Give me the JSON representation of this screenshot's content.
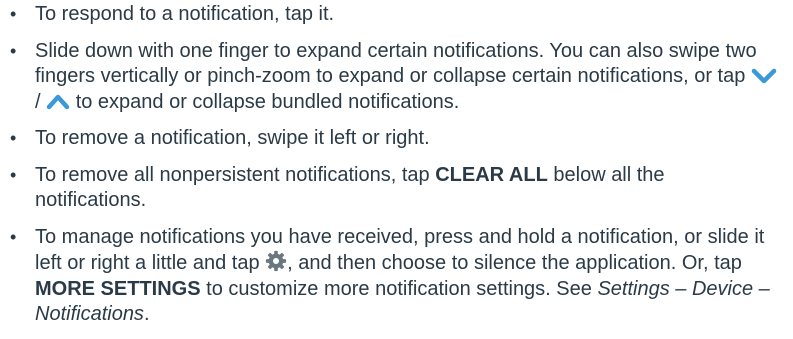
{
  "bullets": [
    {
      "text": "To respond to a notification, tap it."
    },
    {
      "text_before": "Slide down with one finger to expand certain notifications. You can also swipe two fingers vertically or pinch-zoom to expand or collapse certain notifications, or tap",
      "separator": "/",
      "text_after": "to expand or collapse bundled notifications."
    },
    {
      "text": "To remove a notification, swipe it left or right."
    },
    {
      "text_before": "To remove all nonpersistent notifications, tap",
      "bold": "CLEAR ALL",
      "text_after": "below all the notifications."
    },
    {
      "text_before": "To manage notifications you have received, press and hold a notification, or slide it left or right a little and tap",
      "text_middle": ", and then choose to silence the application. Or, tap",
      "bold": "MORE SETTINGS",
      "text_after": "to customize more notification settings. See",
      "italic_ref": "Settings – Device – Notifications",
      "end": "."
    }
  ],
  "bullet_char": "•",
  "icons": {
    "expand": "chevron-down-icon",
    "collapse": "chevron-up-icon",
    "settings": "gear-icon",
    "icon_color": "#3a9ad9",
    "gear_color": "#6b7780"
  }
}
